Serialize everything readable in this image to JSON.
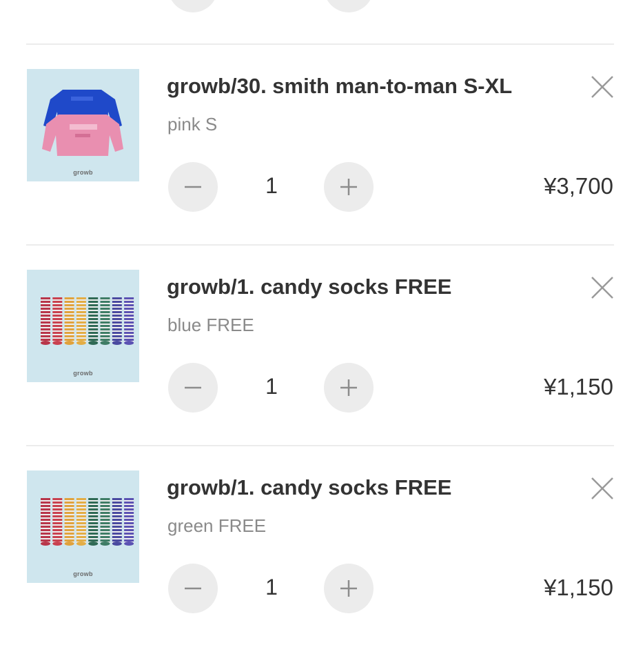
{
  "cart": {
    "items": [
      {
        "name": "growb/30. smith man-to-man S-XL",
        "variant": "pink S",
        "quantity": "1",
        "price": "¥3,700",
        "thumb_brand": "growb",
        "thumb_kind": "sweatshirts",
        "thumb_colors": [
          "#1f49c9",
          "#e98fb0"
        ]
      },
      {
        "name": "growb/1. candy socks FREE",
        "variant": "blue FREE",
        "quantity": "1",
        "price": "¥1,150",
        "thumb_brand": "growb",
        "thumb_kind": "socks"
      },
      {
        "name": "growb/1. candy socks FREE",
        "variant": "green FREE",
        "quantity": "1",
        "price": "¥1,150",
        "thumb_brand": "growb",
        "thumb_kind": "socks"
      }
    ]
  },
  "icons": {
    "decrease": "minus-icon",
    "increase": "plus-icon",
    "remove": "close-icon"
  },
  "colors": {
    "button_bg": "#ececec",
    "thumb_bg": "#cfe6ee",
    "text": "#333333",
    "muted_text": "#8a8a8a",
    "divider": "#ececec"
  }
}
